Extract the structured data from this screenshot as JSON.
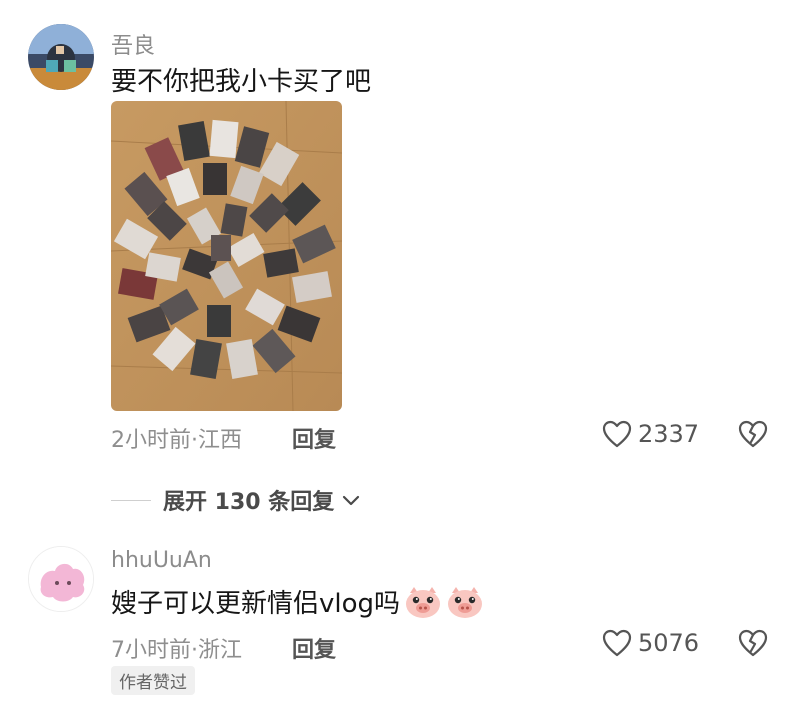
{
  "comments": [
    {
      "username": "吾良",
      "text": "要不你把我小卡买了吧",
      "time_location": "2小时前·江西",
      "reply_label": "回复",
      "likes": "2337",
      "expand_label": "展开 130 条回复"
    },
    {
      "username": "hhuUuAn",
      "text": "嫂子可以更新情侣vlog吗",
      "emojis": [
        "pig-face-icon",
        "pig-face-icon"
      ],
      "time_location": "7小时前·浙江",
      "reply_label": "回复",
      "likes": "5076",
      "badge": "作者赞过"
    }
  ],
  "colors": {
    "username": "#8c8c8c",
    "text": "#161616",
    "meta": "#8e8e8e",
    "badge_bg": "#f0f0f0"
  }
}
